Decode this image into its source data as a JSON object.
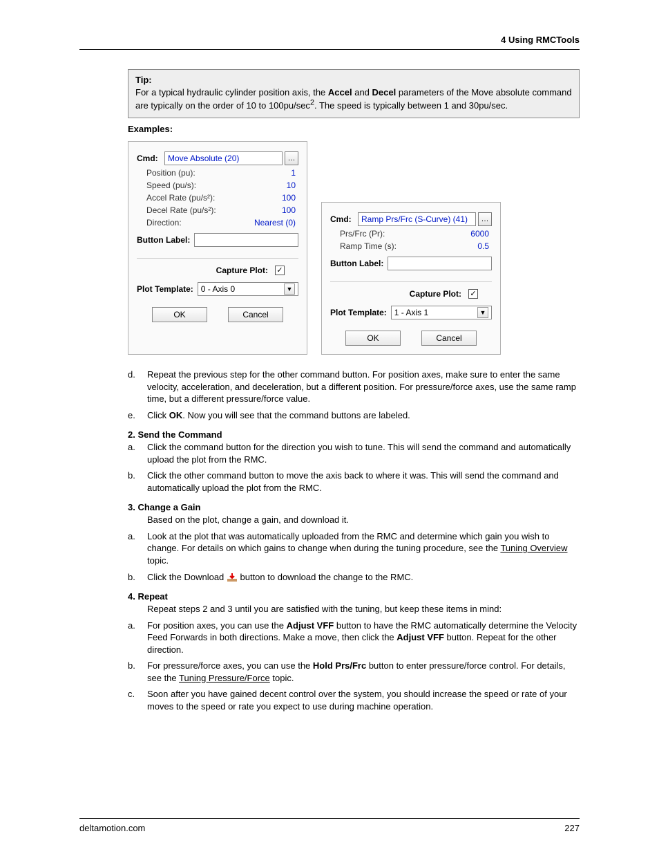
{
  "header": {
    "section": "4  Using RMCTools"
  },
  "tip": {
    "label": "Tip:",
    "body_pre": "For a typical hydraulic cylinder position axis, the ",
    "accel": "Accel",
    "mid1": " and ",
    "decel": "Decel",
    "body_mid": " parameters of the Move absolute command are typically on the order of 10 to 100pu/sec",
    "exp": "2",
    "body_post": ". The speed is typically between 1 and 30pu/sec."
  },
  "examples_label": "Examples:",
  "dialog1": {
    "cmd_label": "Cmd:",
    "cmd_value": "Move Absolute (20)",
    "rows": [
      {
        "label": "Position (pu):",
        "value": "1"
      },
      {
        "label": "Speed (pu/s):",
        "value": "10"
      },
      {
        "label": "Accel Rate (pu/s²):",
        "value": "100"
      },
      {
        "label": "Decel Rate (pu/s²):",
        "value": "100"
      },
      {
        "label": "Direction:",
        "value": "Nearest (0)"
      }
    ],
    "button_label": "Button Label:",
    "capture_label": "Capture Plot:",
    "plot_template_label": "Plot Template:",
    "plot_template_value": "0 - Axis 0",
    "ok": "OK",
    "cancel": "Cancel"
  },
  "dialog2": {
    "cmd_label": "Cmd:",
    "cmd_value": "Ramp Prs/Frc (S-Curve) (41)",
    "rows": [
      {
        "label": "Prs/Frc (Pr):",
        "value": "6000"
      },
      {
        "label": "Ramp Time (s):",
        "value": "0.5"
      }
    ],
    "button_label": "Button Label:",
    "capture_label": "Capture Plot:",
    "plot_template_label": "Plot Template:",
    "plot_template_value": "1 - Axis 1",
    "ok": "OK",
    "cancel": "Cancel"
  },
  "steps": {
    "d": "Repeat the previous step for the other command button. For position axes, make sure to enter the same velocity, acceleration, and deceleration, but a different position. For pressure/force axes, use the same ramp time, but a different pressure/force value.",
    "e_pre": "Click ",
    "e_ok": "OK",
    "e_post": ". Now you will see that the command buttons are labeled.",
    "h2": "2. Send the Command",
    "s2a": "Click the command button for the direction you wish to tune. This will send the command and automatically upload the plot from the RMC.",
    "s2b": "Click the other command button to move the axis back to where it was. This will send the command and automatically upload the plot from the RMC.",
    "h3": "3. Change a Gain",
    "h3sub": "Based on the plot, change a gain, and download it.",
    "s3a_pre": "Look at the plot that was automatically uploaded from the RMC and determine which gain you wish to change. For details on which gains to change when during the tuning procedure, see the ",
    "s3a_link": "Tuning Overview",
    "s3a_post": " topic.",
    "s3b_pre": "Click the Download ",
    "s3b_post": " button to download the change to the RMC.",
    "h4": "4. Repeat",
    "h4sub": "Repeat steps 2 and 3 until you are satisfied with the tuning, but keep these items in mind:",
    "s4a_pre": "For position axes, you can use the ",
    "s4a_b1": "Adjust VFF",
    "s4a_mid": " button to have the RMC automatically determine the Velocity Feed Forwards in both directions. Make a move, then click the ",
    "s4a_b2": "Adjust VFF",
    "s4a_post": " button. Repeat for the other direction.",
    "s4b_pre": "For pressure/force axes, you can use the ",
    "s4b_b": "Hold Prs/Frc",
    "s4b_mid": " button to enter pressure/force control. For details, see the ",
    "s4b_link": "Tuning Pressure/Force",
    "s4b_post": " topic.",
    "s4c": "Soon after you have gained decent control over the system, you should increase the speed or rate of your moves to the speed or rate you expect to use during machine operation."
  },
  "footer": {
    "site": "deltamotion.com",
    "page": "227"
  },
  "markers": {
    "d": "d.",
    "e": "e.",
    "a": "a.",
    "b": "b.",
    "c": "c."
  }
}
